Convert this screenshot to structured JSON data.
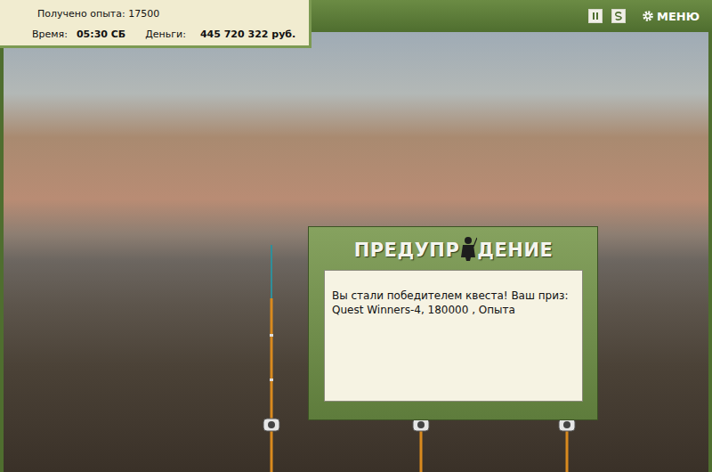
{
  "hud": {
    "experience": "Получено опыта: 17500",
    "time_label": "Время:",
    "time": "05:30 СБ",
    "money_label": "Деньги:",
    "money": "445 720 322 руб."
  },
  "toolbar": {
    "menu": "МЕНЮ"
  },
  "dialog": {
    "title_start": "ПРЕДУПР",
    "title_end": "ДЕНИЕ",
    "message": "Вы стали победителем квеста! Ваш приз: Quest Winners-4, 180000 , Опыта"
  }
}
